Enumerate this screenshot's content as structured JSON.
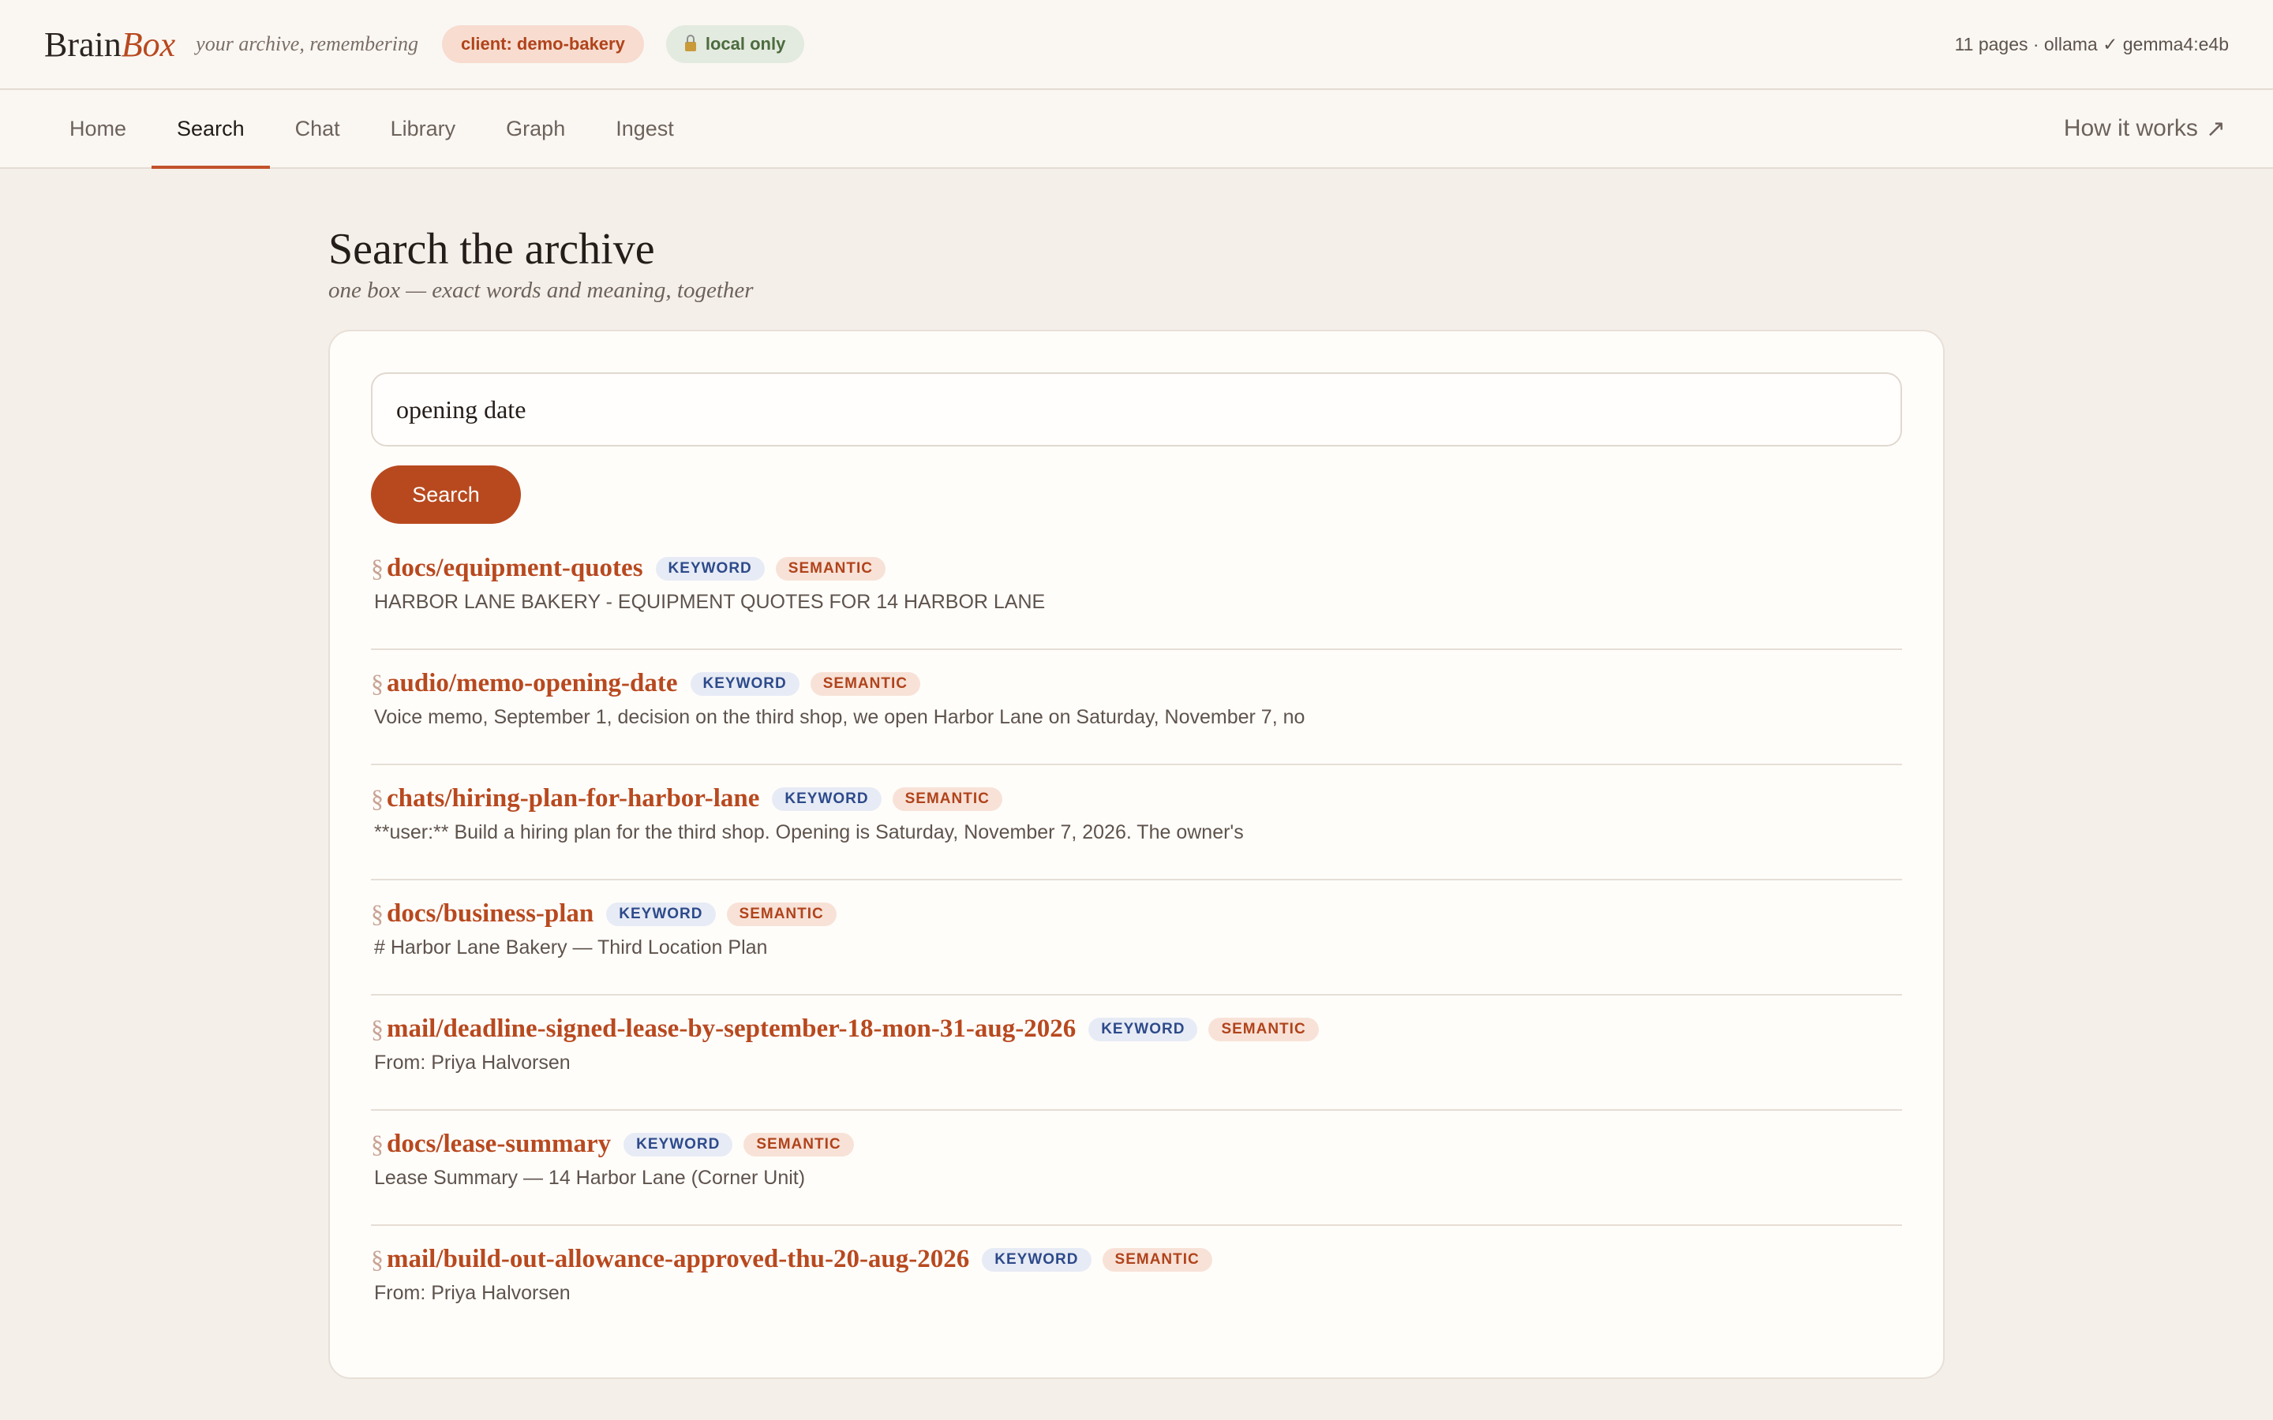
{
  "header": {
    "logo_brain": "Brain",
    "logo_box": "Box",
    "tagline": "your archive, remembering",
    "client_pill": "client: demo-bakery",
    "local_pill": "local only",
    "status": "11 pages · ollama ✓ gemma4:e4b",
    "icons": {
      "lock": "lock-icon"
    }
  },
  "nav": {
    "tabs": [
      {
        "label": "Home"
      },
      {
        "label": "Search",
        "active": true
      },
      {
        "label": "Chat"
      },
      {
        "label": "Library"
      },
      {
        "label": "Graph"
      },
      {
        "label": "Ingest"
      }
    ],
    "how_it_works": "How it works",
    "how_arrow": "↗"
  },
  "main": {
    "title": "Search the archive",
    "subtitle": "one box — exact words and meaning, together",
    "search": {
      "value": "opening date",
      "button_label": "Search"
    }
  },
  "results": [
    {
      "title": "docs/equipment-quotes",
      "badges": [
        "KEYWORD",
        "SEMANTIC"
      ],
      "snippet": "HARBOR LANE BAKERY - EQUIPMENT QUOTES FOR 14 HARBOR LANE"
    },
    {
      "title": "audio/memo-opening-date",
      "badges": [
        "KEYWORD",
        "SEMANTIC"
      ],
      "snippet": "Voice memo, September 1, decision on the third shop, we open Harbor Lane on Saturday, November 7, no"
    },
    {
      "title": "chats/hiring-plan-for-harbor-lane",
      "badges": [
        "KEYWORD",
        "SEMANTIC"
      ],
      "snippet": "**user:** Build a hiring plan for the third shop. Opening is Saturday, November 7, 2026. The owner's"
    },
    {
      "title": "docs/business-plan",
      "badges": [
        "KEYWORD",
        "SEMANTIC"
      ],
      "snippet": "# Harbor Lane Bakery — Third Location Plan"
    },
    {
      "title": "mail/deadline-signed-lease-by-september-18-mon-31-aug-2026",
      "badges": [
        "KEYWORD",
        "SEMANTIC"
      ],
      "snippet": "From: Priya Halvorsen"
    },
    {
      "title": "docs/lease-summary",
      "badges": [
        "KEYWORD",
        "SEMANTIC"
      ],
      "snippet": "Lease Summary — 14 Harbor Lane (Corner Unit)"
    },
    {
      "title": "mail/build-out-allowance-approved-thu-20-aug-2026",
      "badges": [
        "KEYWORD",
        "SEMANTIC"
      ],
      "snippet": "From: Priya Halvorsen"
    }
  ],
  "section_symbol": "§",
  "colors": {
    "accent": "#b8491f",
    "keyword_badge": "#2d4a8a",
    "semantic_badge": "#b0431b"
  }
}
